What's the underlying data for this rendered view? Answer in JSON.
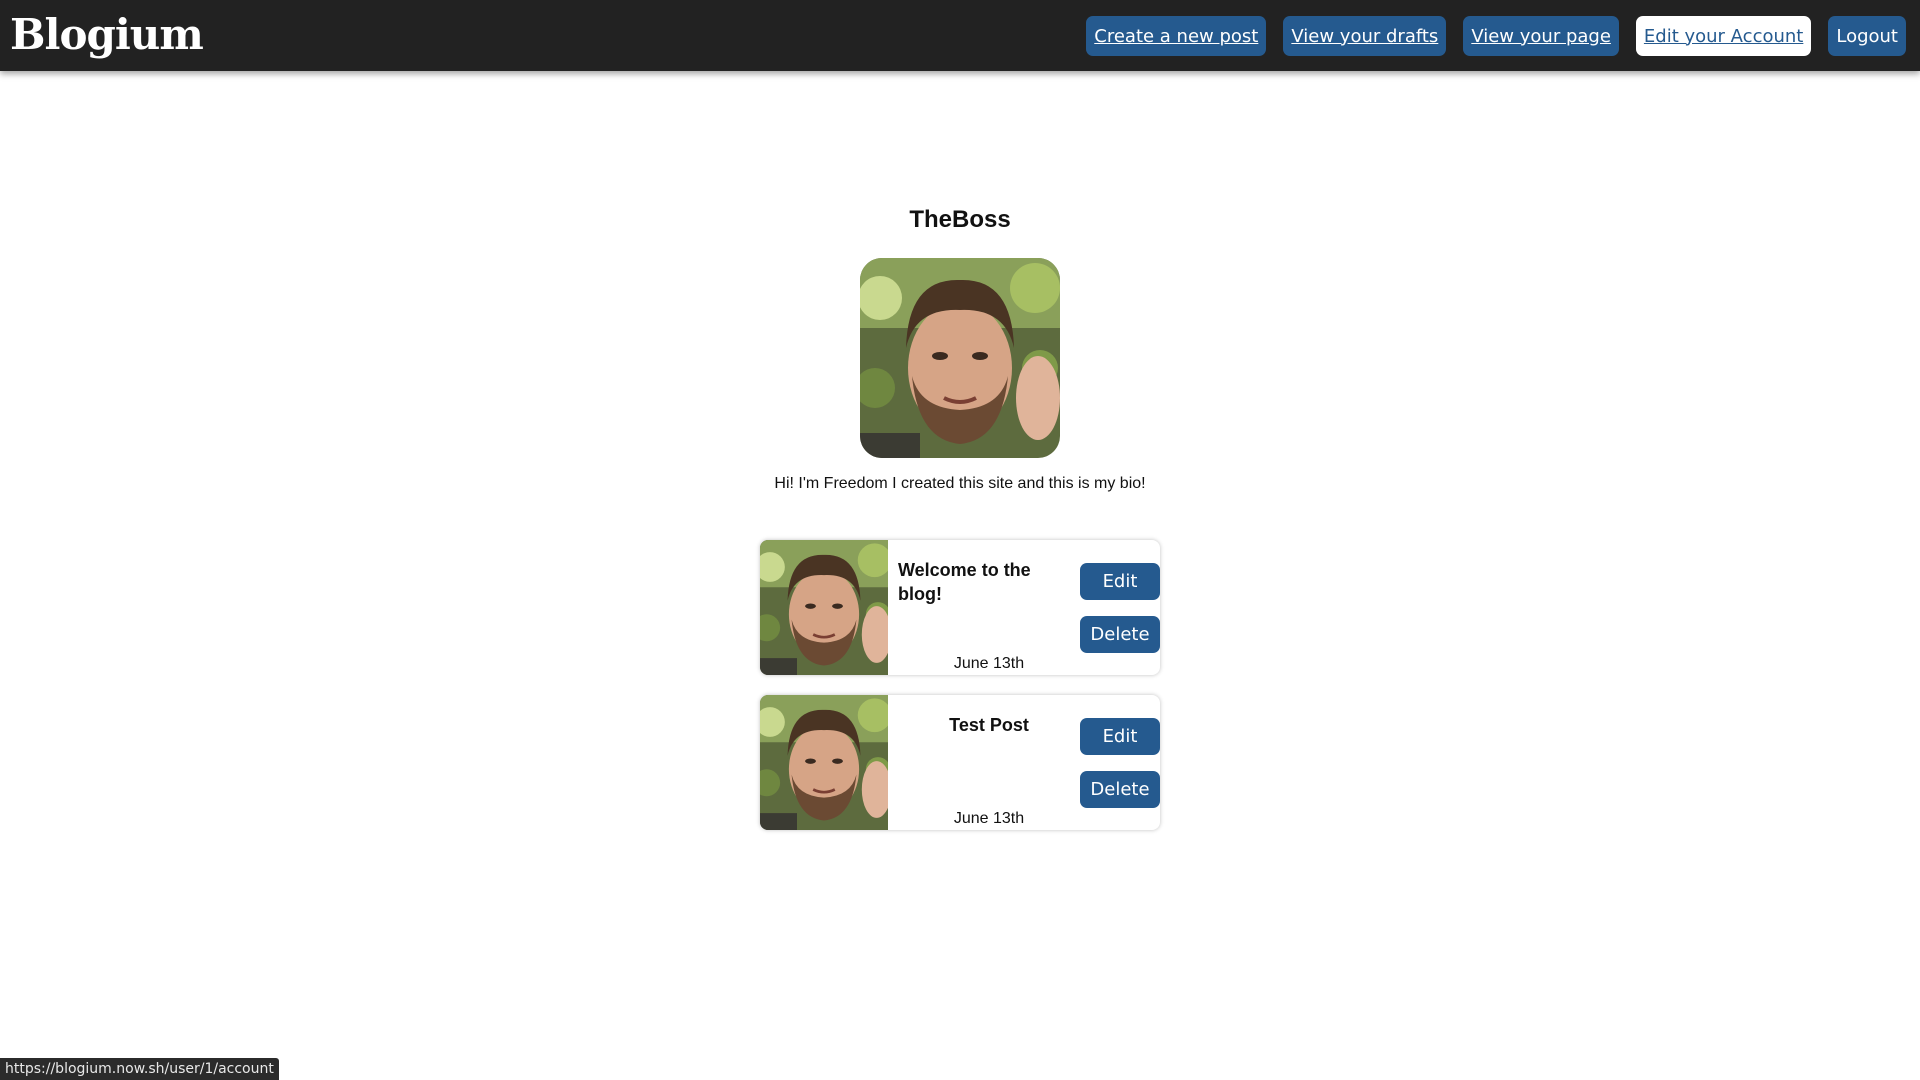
{
  "app": {
    "logo": "Blogium"
  },
  "nav": {
    "create_post": "Create a new post",
    "view_drafts": "View your drafts",
    "view_page": "View your page",
    "edit_account": "Edit your Account",
    "logout": "Logout"
  },
  "profile": {
    "username": "TheBoss",
    "bio": "Hi! I'm Freedom I created this site and this is my bio!"
  },
  "posts": [
    {
      "title": "Welcome to the blog!",
      "date": "June 13th",
      "edit_label": "Edit",
      "delete_label": "Delete"
    },
    {
      "title": "Test Post",
      "date": "June 13th",
      "edit_label": "Edit",
      "delete_label": "Delete"
    }
  ],
  "status_bar": {
    "url": "https://blogium.now.sh/user/1/account"
  },
  "colors": {
    "navbar": "#222222",
    "accent": "#255a8f",
    "page": "#ffffff"
  }
}
